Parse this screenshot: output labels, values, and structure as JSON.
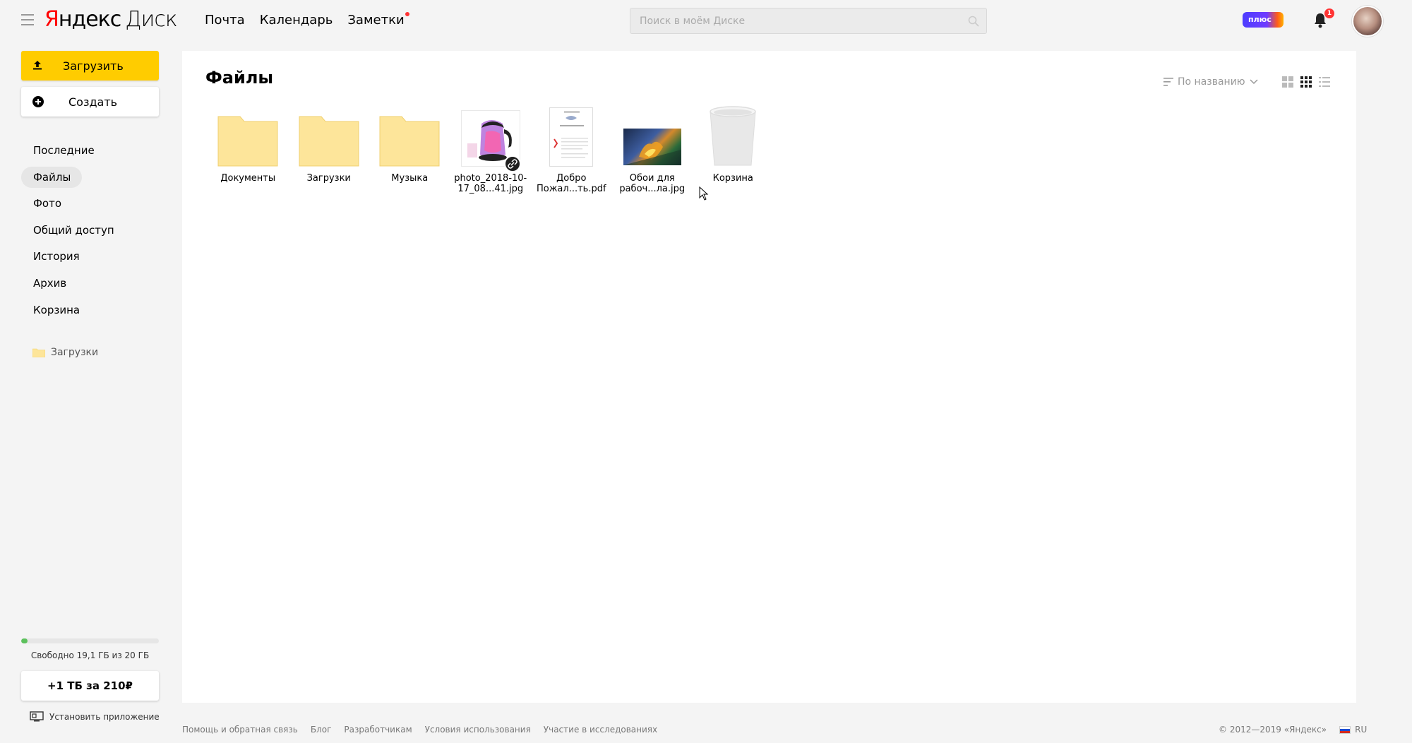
{
  "header": {
    "logo_yandex_first": "Я",
    "logo_yandex_rest": "ндекс",
    "logo_product": "Диск",
    "nav": [
      {
        "label": "Почта"
      },
      {
        "label": "Календарь"
      },
      {
        "label": "Заметки"
      }
    ],
    "search_placeholder": "Поиск в моём Диске",
    "plus_label": "плюс",
    "notification_count": "1"
  },
  "sidebar": {
    "upload_label": "Загрузить",
    "create_label": "Создать",
    "menu": [
      {
        "label": "Последние"
      },
      {
        "label": "Файлы"
      },
      {
        "label": "Фото"
      },
      {
        "label": "Общий доступ"
      },
      {
        "label": "История"
      },
      {
        "label": "Архив"
      },
      {
        "label": "Корзина"
      }
    ],
    "active_menu": "Файлы",
    "folder_shortcut": "Загрузки",
    "quota_used_fraction": 0.045,
    "quota_text": "Свободно 19,1 ГБ из 20 ГБ",
    "buy_label": "+1 ТБ за 210₽",
    "install_label": "Установить приложение"
  },
  "main": {
    "title": "Файлы",
    "sort_label": "По названию",
    "files": [
      {
        "name": "Документы",
        "type": "folder"
      },
      {
        "name": "Загрузки",
        "type": "folder"
      },
      {
        "name": "Музыка",
        "type": "folder"
      },
      {
        "name": "photo_2018-10-17_08...41.jpg",
        "type": "image",
        "shared": true
      },
      {
        "name": "Добро Пожал...ть.pdf",
        "type": "pdf"
      },
      {
        "name": "Обои для рабоч...ла.jpg",
        "type": "image"
      },
      {
        "name": "Корзина",
        "type": "trash"
      }
    ]
  },
  "footer": {
    "links": [
      {
        "label": "Помощь и обратная связь"
      },
      {
        "label": "Блог"
      },
      {
        "label": "Разработчикам"
      },
      {
        "label": "Условия использования"
      },
      {
        "label": "Участие в исследованиях"
      }
    ],
    "copyright": "© 2012—2019 «Яндекс»",
    "lang": "RU"
  },
  "colors": {
    "accent_yellow": "#ffcc00",
    "folder": "#fde59a",
    "background": "#f4f4f4",
    "quota_fill": "#5cc15c"
  },
  "icons": [
    "menu-icon",
    "search-icon",
    "bell-icon",
    "upload-icon",
    "plus-circle-icon",
    "folder-icon",
    "sort-icon",
    "tiles-large-icon",
    "tiles-icon",
    "list-icon",
    "link-icon",
    "computer-icon",
    "trash-icon",
    "cursor-icon"
  ]
}
